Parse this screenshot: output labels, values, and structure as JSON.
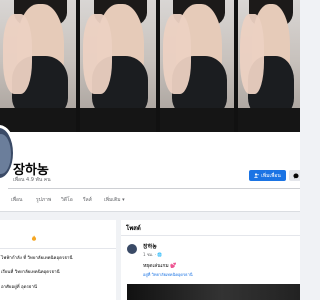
{
  "profile": {
    "name": "장하농",
    "friends_text": "เพื่อน 4.9 พัน คน"
  },
  "actions": {
    "add_friend_label": "เพิ่มเพื่อน",
    "message_icon": "messenger-icon"
  },
  "tabs": [
    {
      "label": "เพื่อน"
    },
    {
      "label": "รูปภาพ"
    },
    {
      "label": "วิดีโอ"
    },
    {
      "label": "รีลส์"
    },
    {
      "label": "เพิ่มเติม ▾"
    }
  ],
  "intro": {
    "rows": [
      {
        "label": "ไฟฟ้ากำลัง ที่ วิทยาลัยเทคนิคอุดรธานี"
      },
      {
        "label": "เรียนที่ วิทยาลัยเทคนิคอุดรธานี"
      },
      {
        "label": "อาศัยอยู่ที่ อุดรธานี"
      }
    ]
  },
  "posts": {
    "title": "โพสต์",
    "items": [
      {
        "author": "장하농",
        "meta": "1 ชม. · 🌐",
        "text": "หยุดเล่นเกม 💕",
        "location": "อยู่ที่ วิทยาลัยเทคนิคอุดรธานี"
      }
    ]
  },
  "colors": {
    "accent": "#1b74e4",
    "background": "#f0f2f5"
  }
}
